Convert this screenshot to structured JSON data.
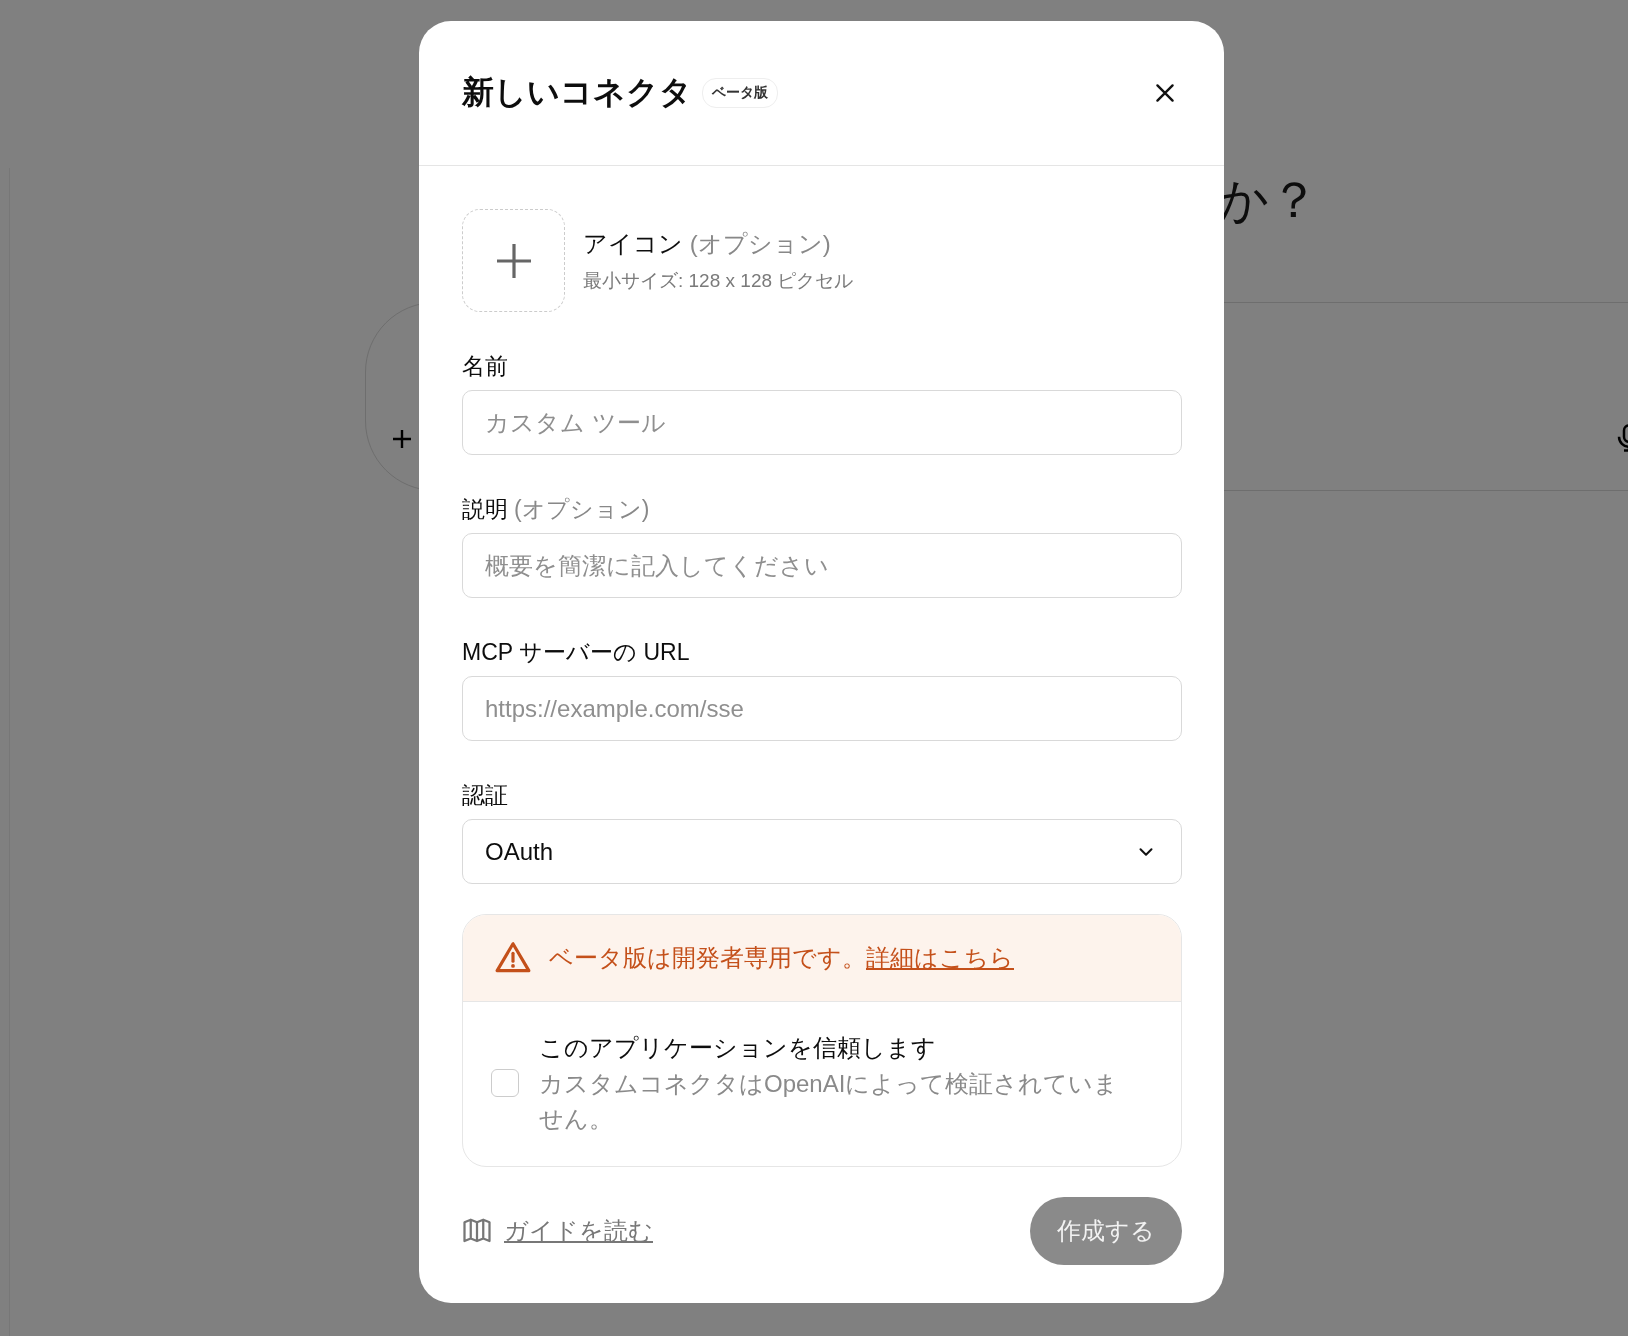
{
  "background": {
    "heading": "か？"
  },
  "dialog": {
    "title": "新しいコネクタ",
    "badge": "ベータ版",
    "icon_upload": {
      "label": "アイコン",
      "hint": "(オプション)",
      "note": "最小サイズ: 128 x 128 ピクセル"
    },
    "fields": [
      {
        "kind": "text",
        "label": "名前",
        "placeholder": "カスタム ツール"
      },
      {
        "kind": "text",
        "label": "説明",
        "hint": "(オプション)",
        "placeholder": "概要を簡潔に記入してください"
      },
      {
        "kind": "text",
        "label": "MCP サーバーの URL",
        "placeholder": "https://example.com/sse"
      },
      {
        "kind": "select",
        "label": "認証",
        "value": "OAuth"
      }
    ],
    "warning": {
      "text": "ベータ版は開発者専用です。",
      "link": "詳細はこちら"
    },
    "trust": {
      "checked": false,
      "label": "このアプリケーションを信頼します",
      "description": "カスタムコネクタはOpenAIによって検証されていません。"
    },
    "guide_link": "ガイドを読む",
    "create_button": {
      "label": "作成する",
      "disabled": true
    }
  }
}
